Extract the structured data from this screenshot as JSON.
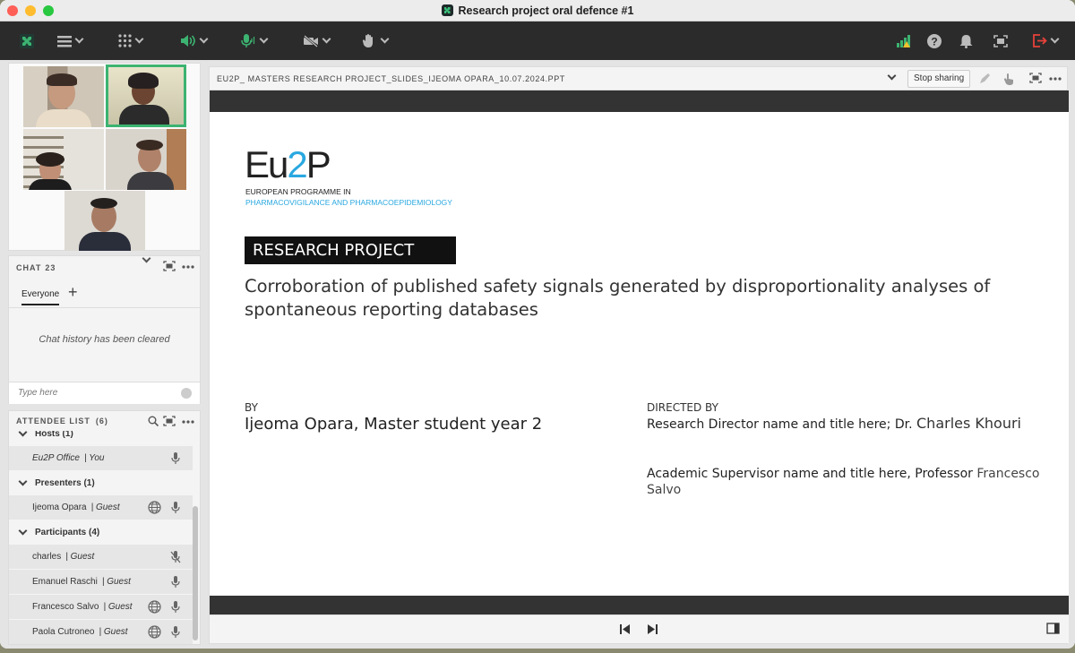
{
  "window": {
    "title": "Research project oral defence #1"
  },
  "toolbar": {
    "icons": [
      "app-logo-icon",
      "menu-icon",
      "apps-grid-icon",
      "speaker-icon",
      "microphone-icon",
      "camera-off-icon",
      "raise-hand-icon",
      "network-status-icon",
      "help-icon",
      "notifications-icon",
      "fullscreen-icon",
      "exit-icon"
    ]
  },
  "chat": {
    "title": "CHAT",
    "count": "23",
    "tab": "Everyone",
    "add": "+",
    "empty": "Chat history has been cleared",
    "input_placeholder": "Type here"
  },
  "attendees": {
    "title": "ATTENDEE LIST",
    "count": "(6)",
    "hosts": "Hosts (1)",
    "presenters": "Presenters (1)",
    "participants": "Participants (4)",
    "host_row": {
      "name": "Eu2P Office",
      "role": "| You"
    },
    "presenter_row": {
      "name": "Ijeoma Opara",
      "role": "| Guest"
    },
    "participant_rows": [
      {
        "name": "charles",
        "role": "| Guest"
      },
      {
        "name": "Emanuel Raschi",
        "role": "| Guest"
      },
      {
        "name": "Francesco Salvo",
        "role": "| Guest"
      },
      {
        "name": "Paola Cutroneo",
        "role": "| Guest"
      }
    ]
  },
  "share": {
    "filename": "EU2P_ MASTERS RESEARCH PROJECT_SLIDES_IJEOMA OPARA_10.07.2024.PPT",
    "stop_label": "Stop sharing"
  },
  "slide": {
    "logo_main_a": "Eu",
    "logo_main_b": "2",
    "logo_main_c": "P",
    "logo_line1": "EUROPEAN PROGRAMME IN",
    "logo_line2": "PHARMACOVIGILANCE AND PHARMACOEPIDEMIOLOGY",
    "banner": "RESEARCH PROJECT",
    "title_line1": "Corroboration of published safety signals generated by disproportionality analyses of",
    "title_line2": "spontaneous reporting databases",
    "by_label": "BY",
    "by_name": "Ijeoma Opara, Master student year 2",
    "directed_label": "DIRECTED BY",
    "director": "Research Director name and title here; Dr.",
    "director_name": "Charles Khouri",
    "supervisor": "Academic Supervisor name and title here, Professor",
    "supervisor_name_a": "Francesco",
    "supervisor_name_b": "Salvo"
  },
  "colors": {
    "accent_green": "#3cb371",
    "logo_blue": "#29a8e0",
    "exit_red": "#e8413b"
  }
}
